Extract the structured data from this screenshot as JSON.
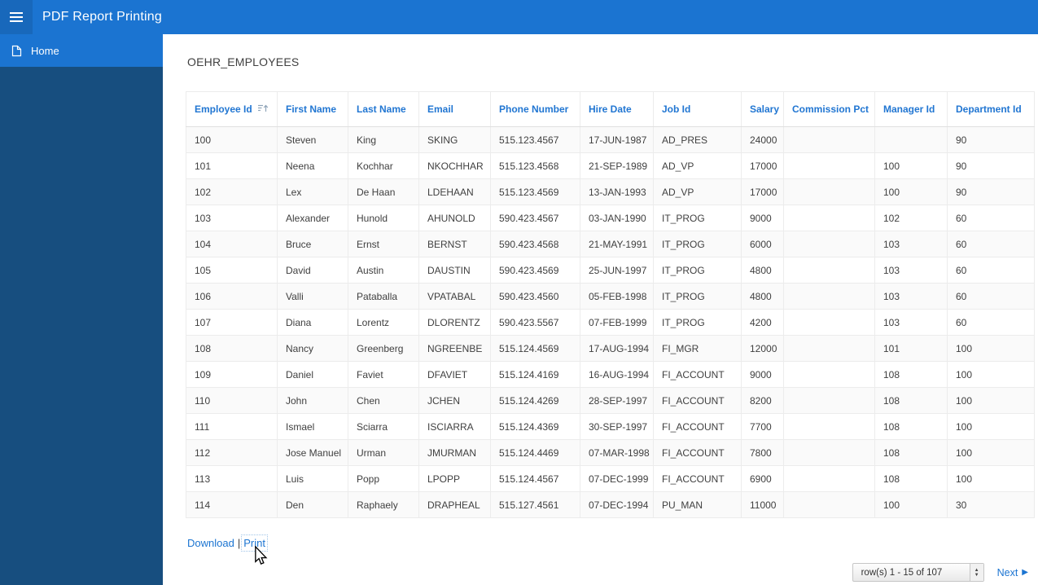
{
  "app": {
    "title": "PDF Report Printing"
  },
  "sidebar": {
    "items": [
      {
        "label": "Home",
        "icon": "page-icon",
        "active": true
      }
    ]
  },
  "region": {
    "title": "OEHR_EMPLOYEES"
  },
  "table": {
    "columns": [
      "Employee Id",
      "First Name",
      "Last Name",
      "Email",
      "Phone Number",
      "Hire Date",
      "Job Id",
      "Salary",
      "Commission Pct",
      "Manager Id",
      "Department Id"
    ],
    "sorted_by": "Employee Id",
    "sort_direction": "ascending",
    "rows": [
      [
        "100",
        "Steven",
        "King",
        "SKING",
        "515.123.4567",
        "17-JUN-1987",
        "AD_PRES",
        "24000",
        "",
        "",
        "90"
      ],
      [
        "101",
        "Neena",
        "Kochhar",
        "NKOCHHAR",
        "515.123.4568",
        "21-SEP-1989",
        "AD_VP",
        "17000",
        "",
        "100",
        "90"
      ],
      [
        "102",
        "Lex",
        "De Haan",
        "LDEHAAN",
        "515.123.4569",
        "13-JAN-1993",
        "AD_VP",
        "17000",
        "",
        "100",
        "90"
      ],
      [
        "103",
        "Alexander",
        "Hunold",
        "AHUNOLD",
        "590.423.4567",
        "03-JAN-1990",
        "IT_PROG",
        "9000",
        "",
        "102",
        "60"
      ],
      [
        "104",
        "Bruce",
        "Ernst",
        "BERNST",
        "590.423.4568",
        "21-MAY-1991",
        "IT_PROG",
        "6000",
        "",
        "103",
        "60"
      ],
      [
        "105",
        "David",
        "Austin",
        "DAUSTIN",
        "590.423.4569",
        "25-JUN-1997",
        "IT_PROG",
        "4800",
        "",
        "103",
        "60"
      ],
      [
        "106",
        "Valli",
        "Pataballa",
        "VPATABAL",
        "590.423.4560",
        "05-FEB-1998",
        "IT_PROG",
        "4800",
        "",
        "103",
        "60"
      ],
      [
        "107",
        "Diana",
        "Lorentz",
        "DLORENTZ",
        "590.423.5567",
        "07-FEB-1999",
        "IT_PROG",
        "4200",
        "",
        "103",
        "60"
      ],
      [
        "108",
        "Nancy",
        "Greenberg",
        "NGREENBE",
        "515.124.4569",
        "17-AUG-1994",
        "FI_MGR",
        "12000",
        "",
        "101",
        "100"
      ],
      [
        "109",
        "Daniel",
        "Faviet",
        "DFAVIET",
        "515.124.4169",
        "16-AUG-1994",
        "FI_ACCOUNT",
        "9000",
        "",
        "108",
        "100"
      ],
      [
        "110",
        "John",
        "Chen",
        "JCHEN",
        "515.124.4269",
        "28-SEP-1997",
        "FI_ACCOUNT",
        "8200",
        "",
        "108",
        "100"
      ],
      [
        "111",
        "Ismael",
        "Sciarra",
        "ISCIARRA",
        "515.124.4369",
        "30-SEP-1997",
        "FI_ACCOUNT",
        "7700",
        "",
        "108",
        "100"
      ],
      [
        "112",
        "Jose Manuel",
        "Urman",
        "JMURMAN",
        "515.124.4469",
        "07-MAR-1998",
        "FI_ACCOUNT",
        "7800",
        "",
        "108",
        "100"
      ],
      [
        "113",
        "Luis",
        "Popp",
        "LPOPP",
        "515.124.4567",
        "07-DEC-1999",
        "FI_ACCOUNT",
        "6900",
        "",
        "108",
        "100"
      ],
      [
        "114",
        "Den",
        "Raphaely",
        "DRAPHEAL",
        "515.127.4561",
        "07-DEC-1994",
        "PU_MAN",
        "11000",
        "",
        "100",
        "30"
      ]
    ]
  },
  "links": {
    "download": "Download",
    "separator": "|",
    "print": "Print"
  },
  "pagination": {
    "range": "row(s) 1 - 15 of 107",
    "next": "Next",
    "next_arrow": "▶"
  }
}
